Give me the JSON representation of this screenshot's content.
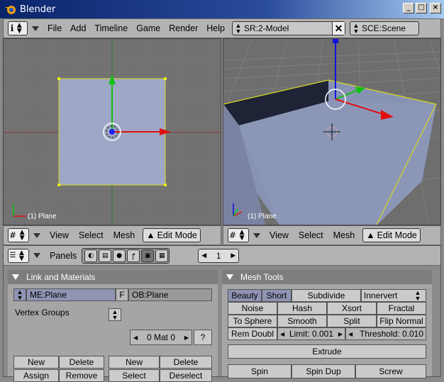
{
  "window": {
    "title": "Blender"
  },
  "topbar": {
    "menus": [
      "File",
      "Add",
      "Timeline",
      "Game",
      "Render",
      "Help"
    ],
    "screen_field": "SR:2-Model",
    "scene_field": "SCE:Scene"
  },
  "viewports": {
    "left": {
      "label": "(1) Plane"
    },
    "right": {
      "label": "(1) Plane"
    }
  },
  "viewport_header": {
    "menus": [
      "View",
      "Select",
      "Mesh"
    ],
    "mode": "Edit Mode"
  },
  "buttons_header": {
    "panels_label": "Panels",
    "frame_value": "1"
  },
  "link_materials": {
    "title": "Link and Materials",
    "mesh_field": "ME:Plane",
    "f_label": "F",
    "object_field": "OB:Plane",
    "vertex_groups_label": "Vertex Groups",
    "mat_field": "0 Mat 0",
    "question_label": "?",
    "buttons": {
      "new1": "New",
      "delete1": "Delete",
      "assign": "Assign",
      "remove": "Remove",
      "new2": "New",
      "delete2": "Delete",
      "select": "Select",
      "deselect": "Deselect"
    }
  },
  "mesh_tools": {
    "title": "Mesh Tools",
    "beauty": "Beauty",
    "short": "Short",
    "subdivide": "Subdivide",
    "innervert": "Innervert",
    "noise": "Noise",
    "hash": "Hash",
    "xsort": "Xsort",
    "fractal": "Fractal",
    "to_sphere": "To Sphere",
    "smooth": "Smooth",
    "split": "Split",
    "flip_normal": "Flip Normal",
    "rem_doubl": "Rem Doubl",
    "limit": "Limit: 0.001",
    "threshold": "Threshold: 0.010",
    "extrude": "Extrude",
    "spin": "Spin",
    "spin_dup": "Spin Dup",
    "screw": "Screw"
  },
  "colors": {
    "title_bar": "#0a246a",
    "plane_face": "#9ea7c5",
    "axis_red": "#e01010",
    "axis_green": "#10c010",
    "axis_blue": "#1010e0",
    "toggle_on": "#8f94b4"
  }
}
